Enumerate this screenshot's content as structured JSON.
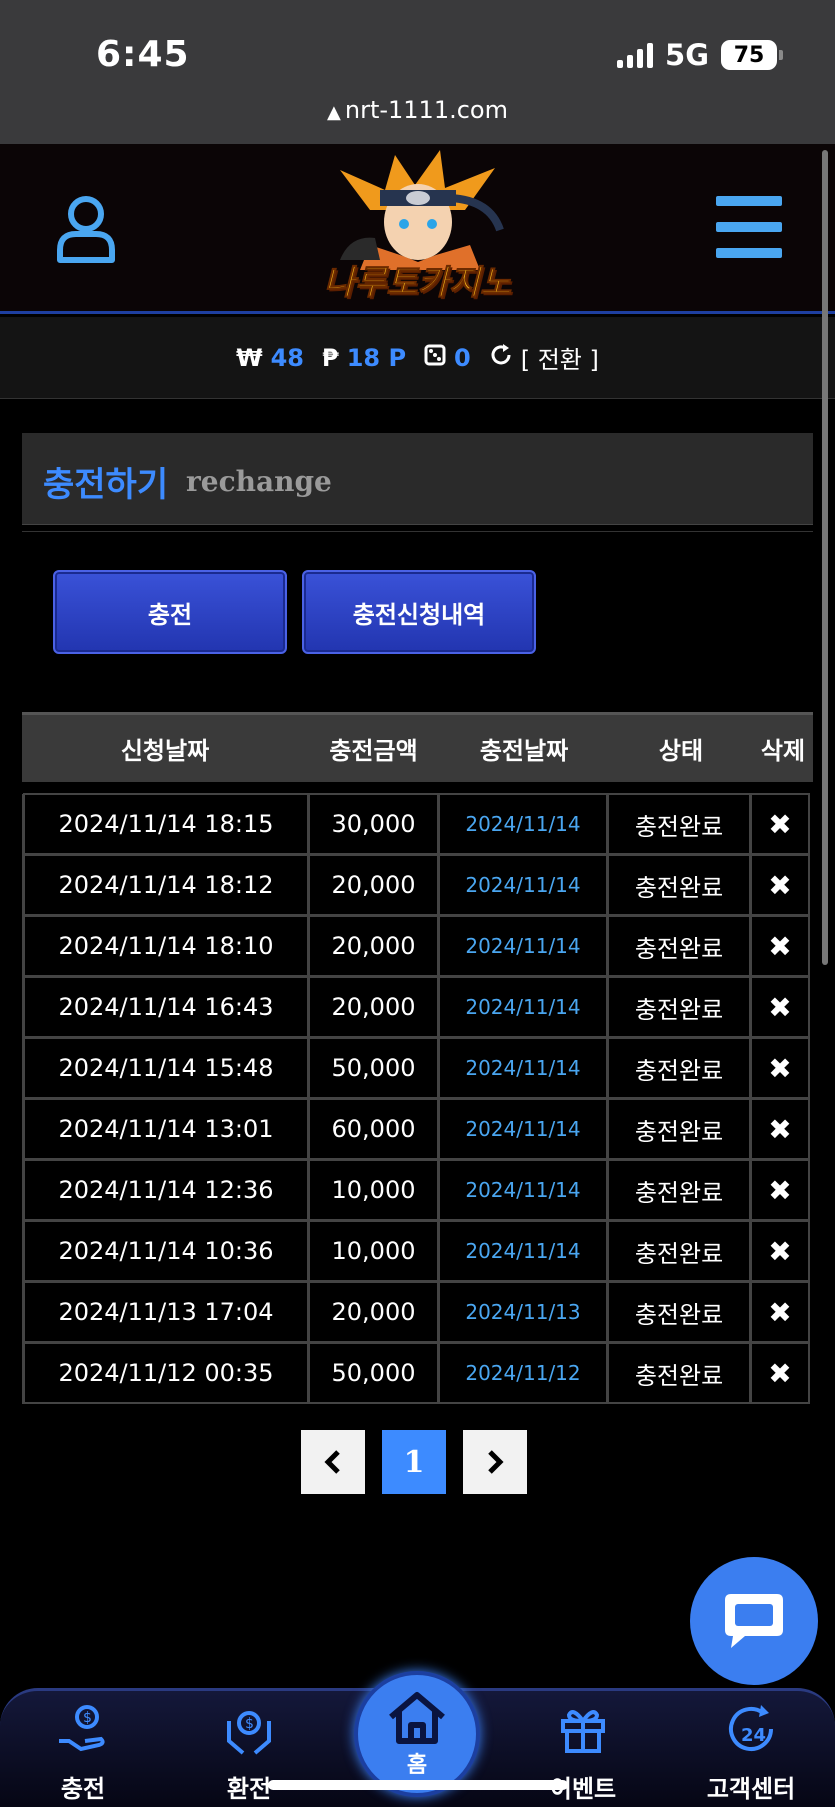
{
  "status_bar": {
    "time": "6:45",
    "network": "5G",
    "battery": "75"
  },
  "browser": {
    "url": "nrt-1111.com"
  },
  "header": {
    "logo_text": "나루토카지노",
    "user_icon": "user-icon",
    "menu_icon": "hamburger-menu-icon"
  },
  "balance": {
    "won_symbol": "₩",
    "won_value": "48",
    "point_symbol": "₱",
    "point_value": "18 P",
    "casino_value": "0",
    "convert_label": "[ 전환 ]"
  },
  "section": {
    "title_ko": "충전하기",
    "title_en": "rechange"
  },
  "actions": {
    "charge_label": "충전",
    "history_label": "충전신청내역"
  },
  "table": {
    "headers": [
      "신청날짜",
      "충전금액",
      "충전날짜",
      "상태",
      "삭제"
    ],
    "rows": [
      {
        "requested": "2024/11/14 18:15",
        "amount": "30,000",
        "charged": "2024/11/14",
        "status": "충전완료",
        "delete": "✖"
      },
      {
        "requested": "2024/11/14 18:12",
        "amount": "20,000",
        "charged": "2024/11/14",
        "status": "충전완료",
        "delete": "✖"
      },
      {
        "requested": "2024/11/14 18:10",
        "amount": "20,000",
        "charged": "2024/11/14",
        "status": "충전완료",
        "delete": "✖"
      },
      {
        "requested": "2024/11/14 16:43",
        "amount": "20,000",
        "charged": "2024/11/14",
        "status": "충전완료",
        "delete": "✖"
      },
      {
        "requested": "2024/11/14 15:48",
        "amount": "50,000",
        "charged": "2024/11/14",
        "status": "충전완료",
        "delete": "✖"
      },
      {
        "requested": "2024/11/14 13:01",
        "amount": "60,000",
        "charged": "2024/11/14",
        "status": "충전완료",
        "delete": "✖"
      },
      {
        "requested": "2024/11/14 12:36",
        "amount": "10,000",
        "charged": "2024/11/14",
        "status": "충전완료",
        "delete": "✖"
      },
      {
        "requested": "2024/11/14 10:36",
        "amount": "10,000",
        "charged": "2024/11/14",
        "status": "충전완료",
        "delete": "✖"
      },
      {
        "requested": "2024/11/13 17:04",
        "amount": "20,000",
        "charged": "2024/11/13",
        "status": "충전완료",
        "delete": "✖"
      },
      {
        "requested": "2024/11/12 00:35",
        "amount": "50,000",
        "charged": "2024/11/12",
        "status": "충전완료",
        "delete": "✖"
      }
    ]
  },
  "pagination": {
    "prev": "‹",
    "current": "1",
    "next": "›"
  },
  "bottom_nav": {
    "charge": "충전",
    "exchange": "환전",
    "home": "홈",
    "event": "이벤트",
    "support": "고객센터"
  },
  "colors": {
    "accent_blue": "#3d8bff",
    "button_blue": "#2a3fc8",
    "header_border": "#1e3fa0"
  }
}
